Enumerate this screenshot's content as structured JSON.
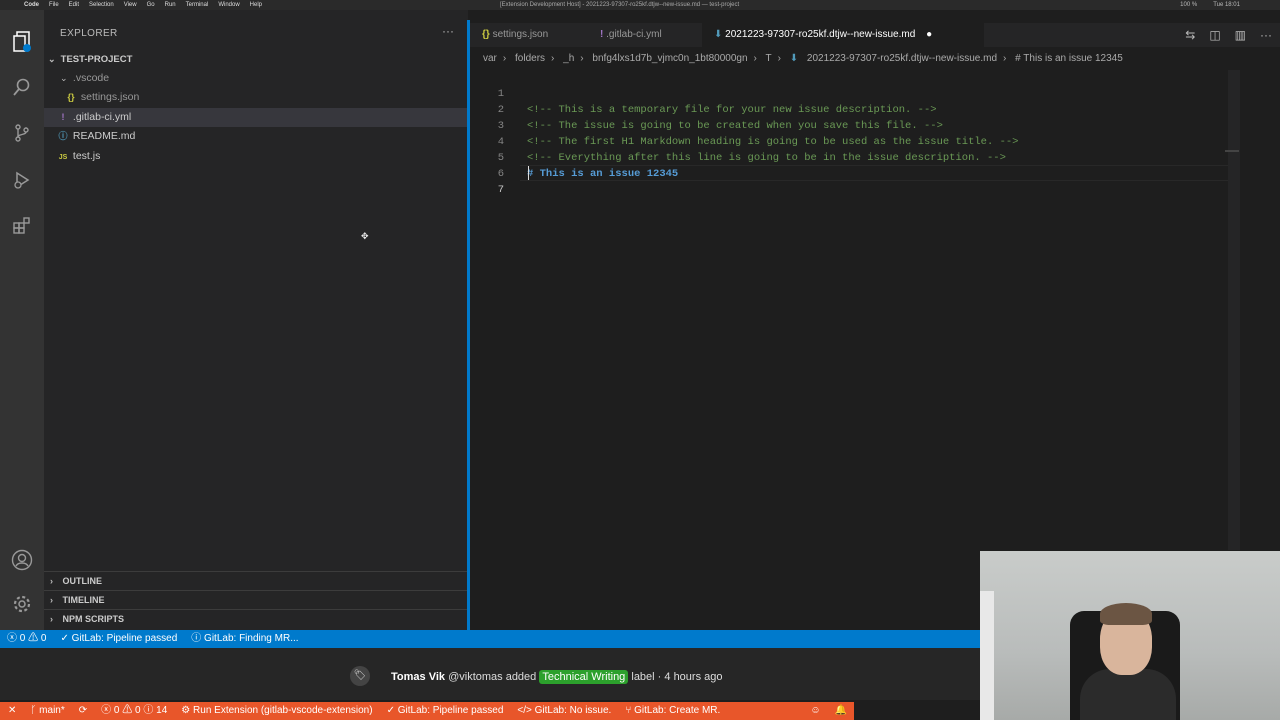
{
  "menubar": {
    "items": [
      "Code",
      "File",
      "Edit",
      "Selection",
      "View",
      "Go",
      "Run",
      "Terminal",
      "Window",
      "Help"
    ],
    "title": "[Extension Development Host] - 2021223-97307-ro25kf.dtjw--new-issue.md — test-project",
    "clock": "Tue 18:01",
    "battery": "100 %"
  },
  "sidebar": {
    "title": "EXPLORER",
    "project": "TEST-PROJECT",
    "tree": [
      {
        "label": ".vscode",
        "kind": "folder"
      },
      {
        "label": "settings.json",
        "kind": "json"
      },
      {
        "label": ".gitlab-ci.yml",
        "kind": "yml"
      },
      {
        "label": "README.md",
        "kind": "info"
      },
      {
        "label": "test.js",
        "kind": "js"
      }
    ],
    "sections": [
      "OUTLINE",
      "TIMELINE",
      "NPM SCRIPTS"
    ]
  },
  "tabs": [
    {
      "label": "settings.json"
    },
    {
      "label": ".gitlab-ci.yml"
    },
    {
      "label": "2021223-97307-ro25kf.dtjw--new-issue.md"
    }
  ],
  "breadcrumbs": [
    "var",
    "folders",
    "_h",
    "bnfg4lxs1d7b_vjmc0n_1bt80000gn",
    "T",
    "2021223-97307-ro25kf.dtjw--new-issue.md",
    "# This is an issue 12345"
  ],
  "editor": {
    "lines": [
      {
        "n": "1",
        "text": "<!-- This is a temporary file for your new issue description. -->",
        "cls": "cmt"
      },
      {
        "n": "2",
        "text": "<!-- The issue is going to be created when you save this file. -->",
        "cls": "cmt"
      },
      {
        "n": "3",
        "text": "<!-- The first H1 Markdown heading is going to be used as the issue title. -->",
        "cls": "cmt"
      },
      {
        "n": "4",
        "text": "<!-- Everything after this line is going to be in the issue description. -->",
        "cls": "cmt"
      },
      {
        "n": "5",
        "text": "# This is an issue 12345",
        "cls": "h1"
      },
      {
        "n": "6",
        "text": "",
        "cls": ""
      },
      {
        "n": "7",
        "text": "",
        "cls": ""
      }
    ]
  },
  "statusbar": {
    "problems": "0 ⚠ 0",
    "pipeline": "GitLab: Pipeline passed",
    "finding_mr": "GitLab: Finding MR..."
  },
  "comment": {
    "author": "Tomas Vik",
    "handle": "@viktomas added",
    "label": "Technical Writing",
    "suffix": "label · 4 hours ago"
  },
  "bottombar": {
    "branch": "main*",
    "problems": "0 ⚠ 0 ⓘ 14",
    "run": "Run Extension (gitlab-vscode-extension)",
    "pipeline": "GitLab: Pipeline passed",
    "issue": "GitLab: No issue.",
    "create_mr": "GitLab: Create MR."
  },
  "colors": {
    "accent": "#007acc",
    "remote": "#e8562a",
    "label_green": "#2ca02c"
  }
}
